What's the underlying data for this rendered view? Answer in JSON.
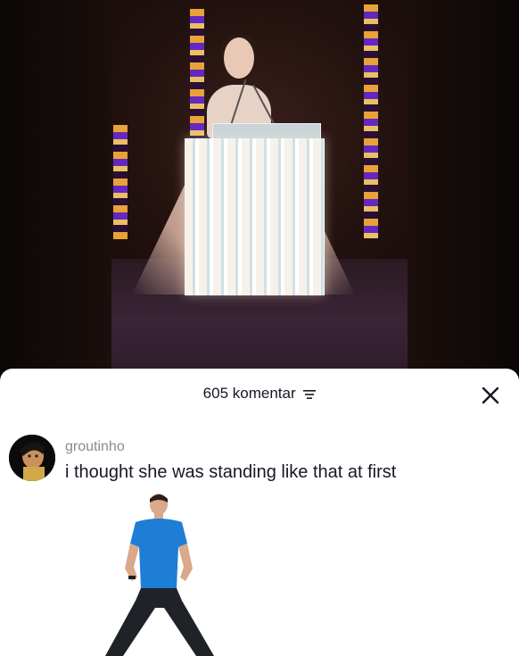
{
  "comments_sheet": {
    "count_label": "605 komentar",
    "comment": {
      "username": "groutinho",
      "text": "i thought she was standing like that at first"
    }
  },
  "icons": {
    "filter": "filter-icon",
    "close": "close-icon"
  },
  "colors": {
    "sheet_bg": "#ffffff",
    "text_primary": "#161823",
    "text_secondary": "#8a8b91"
  }
}
